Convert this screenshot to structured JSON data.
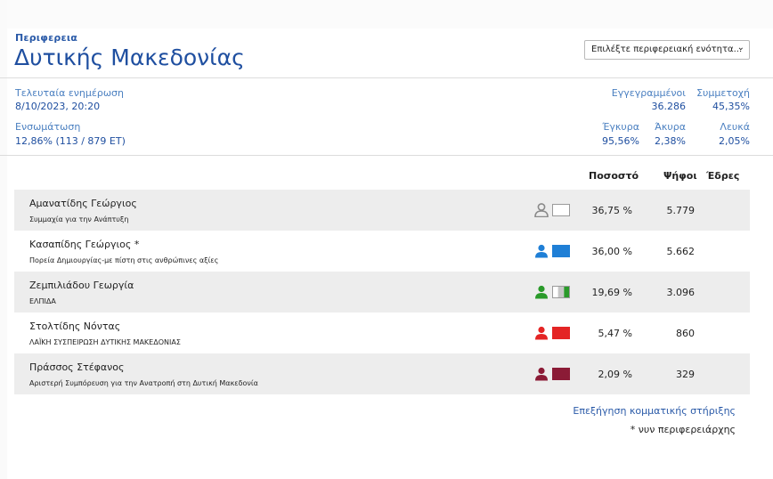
{
  "header": {
    "kicker": "Περιφερεια",
    "title": "Δυτικής Μακεδονίας",
    "select_value": "Επιλέξτε περιφερειακή ενότητα..."
  },
  "meta": {
    "last_update_label": "Τελευταία ενημέρωση",
    "last_update_value": "8/10/2023, 20:20",
    "integration_label": "Ενσωμάτωση",
    "integration_value": "12,86% (113 / 879 ΕΤ)",
    "registered_label": "Εγγεγραμμένοι",
    "registered_value": "36.286",
    "turnout_label": "Συμμετοχή",
    "turnout_value": "45,35%",
    "valid_label": "Έγκυρα",
    "valid_value": "95,56%",
    "invalid_label": "Άκυρα",
    "invalid_value": "2,38%",
    "blank_label": "Λευκά",
    "blank_value": "2,05%"
  },
  "table": {
    "columns": {
      "percent": "Ποσοστό",
      "votes": "Ψήφοι",
      "seats": "Έδρες"
    },
    "rows": [
      {
        "candidate": "Αμανατίδης Γεώργιος",
        "party": "Συμμαχία για την Ανάπτυξη",
        "percent": "36,75 %",
        "votes": "5.779",
        "seats": "",
        "color": "#8a8a8a",
        "flag": [
          "#ffffff"
        ]
      },
      {
        "candidate": "Κασαπίδης Γεώργιος *",
        "party": "Πορεία Δημιουργίας-με πίστη στις ανθρώπινες αξίες",
        "percent": "36,00 %",
        "votes": "5.662",
        "seats": "",
        "color": "#1f7fd6",
        "flag": [
          "#1f7fd6"
        ]
      },
      {
        "candidate": "Ζεμπιλιάδου Γεωργία",
        "party": "ΕΛΠΙΔΑ",
        "percent": "19,69 %",
        "votes": "3.096",
        "seats": "",
        "color": "#2a9a2a",
        "flag": [
          "#ffffff",
          "#c7c7c7",
          "#2a9a2a"
        ]
      },
      {
        "candidate": "Στολτίδης Νόντας",
        "party": "ΛΑΪΚΗ ΣΥΣΠΕΙΡΩΣΗ ΔΥΤΙΚΗΣ ΜΑΚΕΔΟΝΙΑΣ",
        "percent": "5,47 %",
        "votes": "860",
        "seats": "",
        "color": "#e42424",
        "flag": [
          "#e42424"
        ]
      },
      {
        "candidate": "Πράσσος Στέφανος",
        "party": "Αριστερή Συμπόρευση για την Ανατροπή στη Δυτική Μακεδονία",
        "percent": "2,09 %",
        "votes": "329",
        "seats": "",
        "color": "#8b1b36",
        "flag": [
          "#8b1b36"
        ]
      }
    ]
  },
  "footer": {
    "support_link": "Επεξήγηση κομματικής στήριξης",
    "footnote": "* νυν περιφερειάρχης"
  }
}
